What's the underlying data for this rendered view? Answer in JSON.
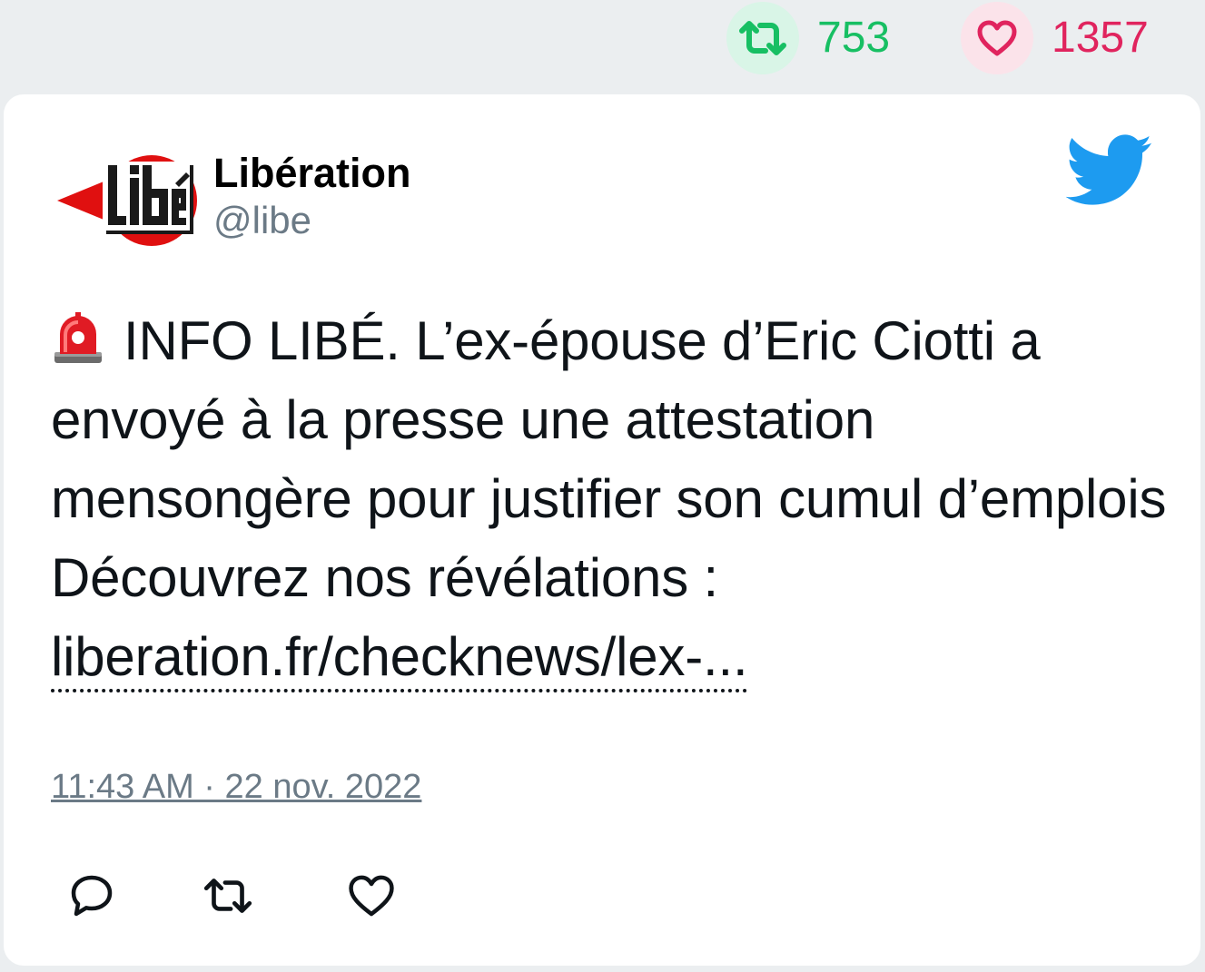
{
  "top_stats": {
    "retweets": "753",
    "likes": "1357"
  },
  "tweet": {
    "author_name": "Libération",
    "author_handle": "@libe",
    "avatar_icon": "libe-logo",
    "platform_icon": "twitter-bird-icon",
    "emoji_icon": "rotating-light-siren-icon",
    "text": "INFO LIBÉ. L’ex-épouse d’Eric Ciotti a envoyé à la presse une attestation mensongère pour justifier son cumul d’emplois Découvrez nos révélations :",
    "link": "liberation.fr/checknews/lex-...",
    "timestamp": "11:43 AM · 22 nov. 2022"
  },
  "colors": {
    "retweet_green": "#17bf63",
    "like_red": "#e0245e",
    "twitter_blue": "#1d9bf0",
    "muted_gray": "#6b7a86"
  }
}
